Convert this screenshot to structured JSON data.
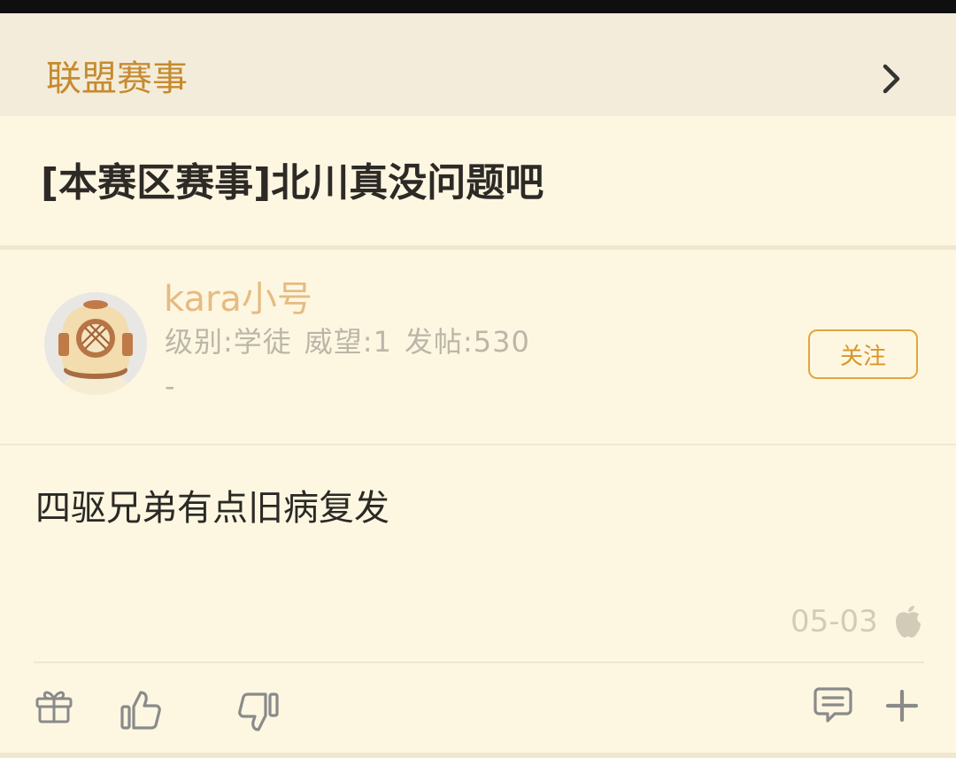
{
  "board": {
    "name": "联盟赛事",
    "chevron_icon": "chevron-right-icon"
  },
  "post": {
    "title": "[本赛区赛事]北川真没问题吧",
    "body": "四驱兄弟有点旧病复发",
    "date": "05-03",
    "device_icon": "apple-icon"
  },
  "author": {
    "avatar_icon": "diving-helmet-avatar",
    "name": "kara小号",
    "level": "级别:学徒",
    "prestige": "威望:1",
    "posts": "发帖:530",
    "signature": "-",
    "follow_label": "关注"
  },
  "actions": {
    "gift_icon": "gift-icon",
    "like_icon": "thumbs-up-icon",
    "dislike_icon": "thumbs-down-icon",
    "comment_icon": "comment-icon",
    "more_icon": "plus-icon"
  },
  "colors": {
    "background": "#fdf7e2",
    "board_bar": "#f3ecda",
    "accent": "#c68a2f",
    "username": "#e6bb82",
    "follow_border": "#e0a73c",
    "muted_text": "#bcb6a8",
    "icon_gray": "#8a8a8a"
  }
}
